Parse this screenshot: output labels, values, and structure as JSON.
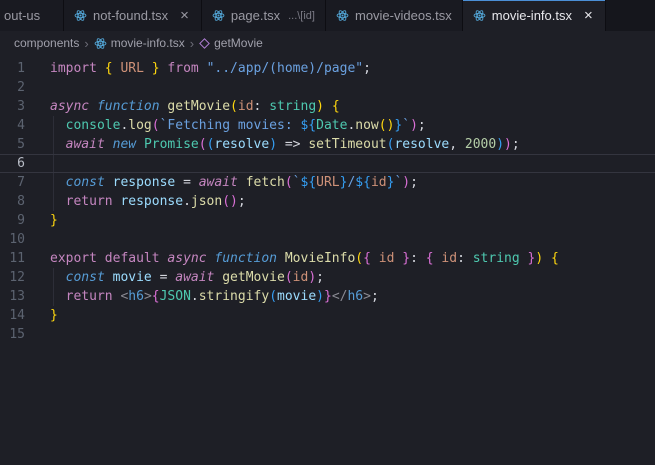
{
  "palette": {
    "ui": {
      "editor_bg": "#1e1f26",
      "tabbar_bg": "#15161c",
      "tab_bg": "#191a21",
      "tab_active_bg": "#1e1f26",
      "tab_fg": "#9a9aa3",
      "tab_active_fg": "#e8e8ec",
      "tab_border": "#0d0d12",
      "accent_top": "#4b8fd6",
      "breadcrumb_fg": "#a0a0ab",
      "desc_fg": "#7a7a85",
      "gutter_fg": "#5c6370",
      "gutter_active_fg": "#b8bcc6",
      "current_line_border": "#34353f",
      "indent_guide": "#2d2e38",
      "react_icon": "#53a7d8",
      "method_icon": "#b180d7"
    },
    "tokens": {
      "p": "#d4d6dd",
      "k1": "#c586c0",
      "k1i": "#c586c0",
      "k2": "#569cd6",
      "fn": "#dcdcaa",
      "cls": "#4ec9b0",
      "v": "#9cdcfe",
      "o": "#ce9178",
      "s": "#6ba1e0",
      "n": "#b5cea8",
      "b1": "#ffd70f",
      "b2": "#da70d6",
      "b3": "#359ff4",
      "tg": "#569cd6",
      "tp": "#8a8a93"
    }
  },
  "icons": {
    "react": "react-logo",
    "method": "method-symbol",
    "close": "×",
    "crumb_sep": "›"
  },
  "tabs": [
    {
      "label": "out-us",
      "icon": false,
      "close": false,
      "active": false,
      "desc": ""
    },
    {
      "label": "not-found.tsx",
      "icon": true,
      "close": true,
      "active": false,
      "desc": ""
    },
    {
      "label": "page.tsx",
      "icon": true,
      "close": false,
      "active": false,
      "desc": "...\\[id]"
    },
    {
      "label": "movie-videos.tsx",
      "icon": true,
      "close": false,
      "active": false,
      "desc": ""
    },
    {
      "label": "movie-info.tsx",
      "icon": true,
      "close": true,
      "active": true,
      "desc": ""
    }
  ],
  "breadcrumb": [
    {
      "label": "components",
      "icon": ""
    },
    {
      "label": "movie-info.tsx",
      "icon": "react"
    },
    {
      "label": "getMovie",
      "icon": "method"
    }
  ],
  "editor": {
    "lines": [
      {
        "n": 1,
        "t": [
          [
            "import",
            "k1"
          ],
          [
            " ",
            "p"
          ],
          [
            "{",
            "b1"
          ],
          [
            " ",
            "p"
          ],
          [
            "URL",
            "o"
          ],
          [
            " ",
            "p"
          ],
          [
            "}",
            "b1"
          ],
          [
            " ",
            "p"
          ],
          [
            "from",
            "k1"
          ],
          [
            " ",
            "p"
          ],
          [
            "\"../app/(home)/page\"",
            "s"
          ],
          [
            ";",
            "p"
          ]
        ]
      },
      {
        "n": 2,
        "t": []
      },
      {
        "n": 3,
        "t": [
          [
            "async",
            "k1i"
          ],
          [
            " ",
            "p"
          ],
          [
            "function",
            "k2"
          ],
          [
            " ",
            "p"
          ],
          [
            "getMovie",
            "fn"
          ],
          [
            "(",
            "b1"
          ],
          [
            "id",
            "o"
          ],
          [
            ": ",
            "p"
          ],
          [
            "string",
            "cls"
          ],
          [
            ")",
            "b1"
          ],
          [
            " ",
            "p"
          ],
          [
            "{",
            "b1"
          ]
        ]
      },
      {
        "n": 4,
        "g": true,
        "t": [
          [
            "  ",
            "p"
          ],
          [
            "console",
            "cls"
          ],
          [
            ".",
            "p"
          ],
          [
            "log",
            "fn"
          ],
          [
            "(",
            "b2"
          ],
          [
            "`Fetching movies: ",
            "s"
          ],
          [
            "${",
            "b3"
          ],
          [
            "Date",
            "cls"
          ],
          [
            ".",
            "p"
          ],
          [
            "now",
            "fn"
          ],
          [
            "()",
            "b1"
          ],
          [
            "}",
            "b3"
          ],
          [
            "`",
            "s"
          ],
          [
            ")",
            "b2"
          ],
          [
            ";",
            "p"
          ]
        ]
      },
      {
        "n": 5,
        "g": true,
        "t": [
          [
            "  ",
            "p"
          ],
          [
            "await",
            "k1i"
          ],
          [
            " ",
            "p"
          ],
          [
            "new",
            "k2"
          ],
          [
            " ",
            "p"
          ],
          [
            "Promise",
            "cls"
          ],
          [
            "(",
            "b2"
          ],
          [
            "(",
            "b3"
          ],
          [
            "resolve",
            "v"
          ],
          [
            ")",
            "b3"
          ],
          [
            " => ",
            "p"
          ],
          [
            "setTimeout",
            "fn"
          ],
          [
            "(",
            "b3"
          ],
          [
            "resolve",
            "v"
          ],
          [
            ", ",
            "p"
          ],
          [
            "2000",
            "n"
          ],
          [
            ")",
            "b3"
          ],
          [
            ")",
            "b2"
          ],
          [
            ";",
            "p"
          ]
        ]
      },
      {
        "n": 6,
        "g": true,
        "c": true,
        "t": []
      },
      {
        "n": 7,
        "g": true,
        "t": [
          [
            "  ",
            "p"
          ],
          [
            "const",
            "k2"
          ],
          [
            " ",
            "p"
          ],
          [
            "response",
            "v"
          ],
          [
            " = ",
            "p"
          ],
          [
            "await",
            "k1i"
          ],
          [
            " ",
            "p"
          ],
          [
            "fetch",
            "fn"
          ],
          [
            "(",
            "b2"
          ],
          [
            "`",
            "s"
          ],
          [
            "${",
            "b3"
          ],
          [
            "URL",
            "o"
          ],
          [
            "}",
            "b3"
          ],
          [
            "/",
            "s"
          ],
          [
            "${",
            "b3"
          ],
          [
            "id",
            "o"
          ],
          [
            "}",
            "b3"
          ],
          [
            "`",
            "s"
          ],
          [
            ")",
            "b2"
          ],
          [
            ";",
            "p"
          ]
        ]
      },
      {
        "n": 8,
        "g": true,
        "t": [
          [
            "  ",
            "p"
          ],
          [
            "return",
            "k1"
          ],
          [
            " ",
            "p"
          ],
          [
            "response",
            "v"
          ],
          [
            ".",
            "p"
          ],
          [
            "json",
            "fn"
          ],
          [
            "()",
            "b2"
          ],
          [
            ";",
            "p"
          ]
        ]
      },
      {
        "n": 9,
        "t": [
          [
            "}",
            "b1"
          ]
        ]
      },
      {
        "n": 10,
        "t": []
      },
      {
        "n": 11,
        "t": [
          [
            "export",
            "k1"
          ],
          [
            " ",
            "p"
          ],
          [
            "default",
            "k1"
          ],
          [
            " ",
            "p"
          ],
          [
            "async",
            "k1i"
          ],
          [
            " ",
            "p"
          ],
          [
            "function",
            "k2"
          ],
          [
            " ",
            "p"
          ],
          [
            "MovieInfo",
            "fn"
          ],
          [
            "(",
            "b1"
          ],
          [
            "{",
            "b2"
          ],
          [
            " ",
            "p"
          ],
          [
            "id",
            "o"
          ],
          [
            " ",
            "p"
          ],
          [
            "}",
            "b2"
          ],
          [
            ": ",
            "p"
          ],
          [
            "{",
            "b2"
          ],
          [
            " ",
            "p"
          ],
          [
            "id",
            "o"
          ],
          [
            ": ",
            "p"
          ],
          [
            "string",
            "cls"
          ],
          [
            " ",
            "p"
          ],
          [
            "}",
            "b2"
          ],
          [
            ")",
            "b1"
          ],
          [
            " ",
            "p"
          ],
          [
            "{",
            "b1"
          ]
        ]
      },
      {
        "n": 12,
        "g": true,
        "t": [
          [
            "  ",
            "p"
          ],
          [
            "const",
            "k2"
          ],
          [
            " ",
            "p"
          ],
          [
            "movie",
            "v"
          ],
          [
            " = ",
            "p"
          ],
          [
            "await",
            "k1i"
          ],
          [
            " ",
            "p"
          ],
          [
            "getMovie",
            "fn"
          ],
          [
            "(",
            "b2"
          ],
          [
            "id",
            "o"
          ],
          [
            ")",
            "b2"
          ],
          [
            ";",
            "p"
          ]
        ]
      },
      {
        "n": 13,
        "g": true,
        "t": [
          [
            "  ",
            "p"
          ],
          [
            "return",
            "k1"
          ],
          [
            " ",
            "p"
          ],
          [
            "<",
            "tp"
          ],
          [
            "h6",
            "tg"
          ],
          [
            ">",
            "tp"
          ],
          [
            "{",
            "b2"
          ],
          [
            "JSON",
            "cls"
          ],
          [
            ".",
            "p"
          ],
          [
            "stringify",
            "fn"
          ],
          [
            "(",
            "b3"
          ],
          [
            "movie",
            "v"
          ],
          [
            ")",
            "b3"
          ],
          [
            "}",
            "b2"
          ],
          [
            "</",
            "tp"
          ],
          [
            "h6",
            "tg"
          ],
          [
            ">",
            "tp"
          ],
          [
            ";",
            "p"
          ]
        ]
      },
      {
        "n": 14,
        "t": [
          [
            "}",
            "b1"
          ]
        ]
      },
      {
        "n": 15,
        "t": []
      }
    ]
  }
}
